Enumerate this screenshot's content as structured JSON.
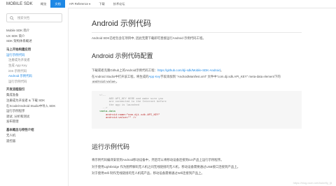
{
  "header": {
    "logo": "MOBILE SDK",
    "nav": [
      "概览",
      "文档",
      "API Reference ▾",
      "下载",
      "技术论坛"
    ],
    "active_index": 1
  },
  "sidebar": {
    "search_placeholder": "搜索文档",
    "group1": [
      "Mobile SDK 简介",
      "UX SDK 简介",
      "SDK 架构体系概述"
    ],
    "group2_head": "马上开始构建应用",
    "group2": [
      {
        "label": "运行示例代码",
        "sub": false,
        "active": true
      },
      {
        "label": "注册成为开发者",
        "sub": true,
        "active": false
      },
      {
        "label": "生成 App Key",
        "sub": true,
        "active": false
      },
      {
        "label": "iOS 示例代码",
        "sub": true,
        "active": false
      },
      {
        "label": "Android 示例代码",
        "sub": true,
        "active": true
      },
      {
        "label": "运行示例代码",
        "sub": true,
        "active": false
      }
    ],
    "group3_head": "开发流程指引",
    "group3": [
      "集成准备",
      "注册成为开发者 & 下载 SDK",
      "在Xcode/Android Studio中导入 SDK",
      "运行示例程序",
      "调试, 分析和测试",
      "发布管理"
    ],
    "group4_head": "基本概念与特性介绍",
    "group4": [
      "无人机",
      "遥控器"
    ]
  },
  "main": {
    "title": "Android 示例代码",
    "intro": "Android SDK已经包含在项目中, 因此无需下载即可直接运行Android 示例代码工程。",
    "config_title": "Android 示例代码配置",
    "download_prefix": "下载或者克隆Github上的Android示例代码工程：",
    "download_link": "https://github.com/dji-sdk/Mobile-SDK-Android",
    "download_suffix": "。",
    "appkey_prefix": "在Android Studio中打开该工程，将生成的",
    "appkey_link": "App Key",
    "appkey_middle": "字段添加到 \"AndroidManifest.xml\" 文件中\"com.dji.sdk.API_KEY\" meta-data element下的",
    "appkey_code": "android:value",
    "appkey_end": "。",
    "code_lines": [
      "<!--",
      "      ADD API_KEY HERE and make sure you",
      "      are connected to the Internet before",
      "      the app is launched",
      "  -->",
      "<meta-data",
      "    android:name=\"com.dji.sdk.API_KEY\"",
      "    android:value=\"\" />"
    ],
    "run_title": "运行示例代码",
    "run_p1": "将示例代码编译安装到Android移动设备中，然后可以将移动设备连接到DJI产品上运行示例程序。",
    "run_p2": "对于使用Lightbridge 作为图传解码无人机之间无线链接的无人机，移动设备需要通过USB接口连接到产品上。",
    "run_p3": "对于使用Wifi 制作无线链接的无人机或产品，移动设备需要通过Wifi连接到产品上。"
  },
  "watermark": "https://blog.csdn.net/Asterfly_ljt"
}
